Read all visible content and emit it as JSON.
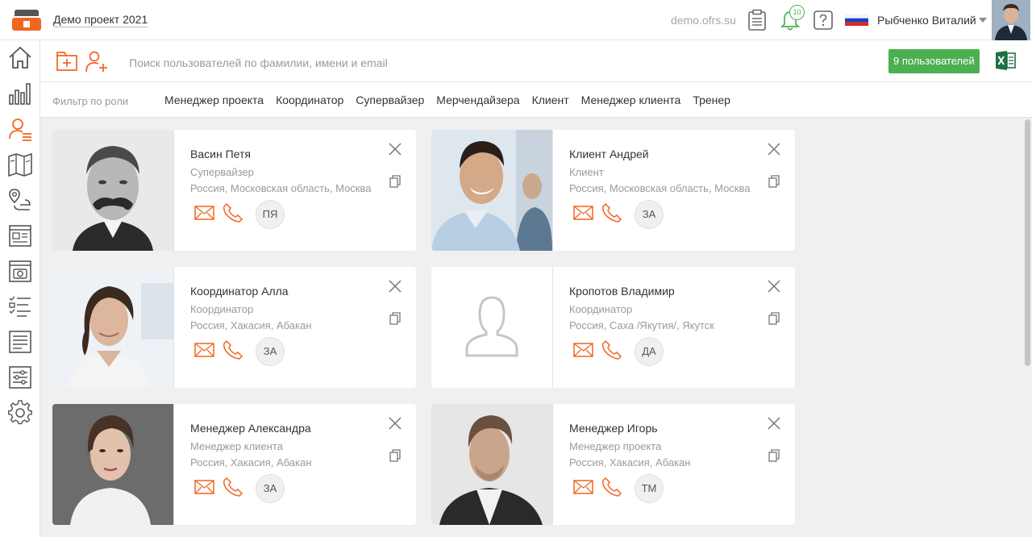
{
  "header": {
    "project_name": "Демо проект 2021",
    "domain": "demo.ofrs.su",
    "notifications_count": "10",
    "user_name": "Рыбченко Виталий",
    "accent_color": "#f26522",
    "success_color": "#4caf50"
  },
  "sidebar": {
    "items": [
      "home-icon",
      "chart-icon",
      "users-icon",
      "map-book-icon",
      "route-icon",
      "news-icon",
      "photo-report-icon",
      "checklist-icon",
      "document-icon",
      "settings-sliders-icon",
      "gear-icon"
    ],
    "active": "users-icon"
  },
  "toolbar": {
    "search_placeholder": "Поиск пользователей по фамилии, имени и email",
    "users_count": "9 пользователей"
  },
  "filter": {
    "label": "Фильтр по роли",
    "roles": [
      "Менеджер проекта",
      "Координатор",
      "Супервайзер",
      "Мерчендайзера",
      "Клиент",
      "Менеджер клиента",
      "Тренер"
    ]
  },
  "users": [
    {
      "name": "Васин Петя",
      "role": "Супервайзер",
      "location": "Россия, Московская область, Москва",
      "initials": "ПЯ",
      "photo": "man-mustache"
    },
    {
      "name": "Клиент Андрей",
      "role": "Клиент",
      "location": "Россия, Московская область, Москва",
      "initials": "ЗА",
      "photo": "man-smiling-office"
    },
    {
      "name": "Координатор Алла",
      "role": "Координатор",
      "location": "Россия, Хакасия, Абакан",
      "initials": "ЗА",
      "photo": "woman-office"
    },
    {
      "name": "Кропотов Владимир",
      "role": "Координатор",
      "location": "Россия, Саха /Якутия/, Якутск",
      "initials": "ДА",
      "photo": "placeholder"
    },
    {
      "name": "Менеджер Александра",
      "role": "Менеджер клиента",
      "location": "Россия, Хакасия, Абакан",
      "initials": "ЗА",
      "photo": "woman-portrait"
    },
    {
      "name": "Менеджер Игорь",
      "role": "Менеджер проекта",
      "location": "Россия, Хакасия, Абакан",
      "initials": "ТМ",
      "photo": "man-portrait"
    }
  ]
}
